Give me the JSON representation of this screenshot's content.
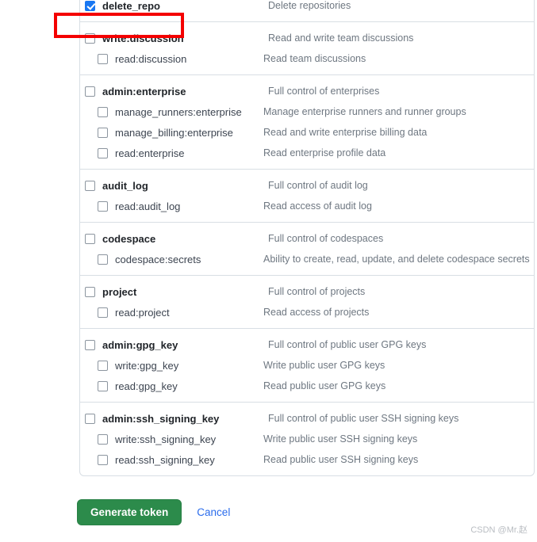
{
  "colors": {
    "accent_checkbox": "#1877f2",
    "primary_button": "#2c8b4b",
    "link": "#2b6cec",
    "highlight_annotation": "#f40000",
    "border": "#d8dee4",
    "description_text": "#6e7781"
  },
  "highlight": {
    "target_scope": "delete_repo"
  },
  "scope_groups": [
    {
      "group_name": "delete_repo-group",
      "rows": [
        {
          "scope": "delete_repo",
          "description": "Delete repositories",
          "checked": true,
          "level": "parent"
        }
      ]
    },
    {
      "group_name": "discussion-group",
      "rows": [
        {
          "scope": "write:discussion",
          "description": "Read and write team discussions",
          "checked": false,
          "level": "parent"
        },
        {
          "scope": "read:discussion",
          "description": "Read team discussions",
          "checked": false,
          "level": "child"
        }
      ]
    },
    {
      "group_name": "enterprise-group",
      "rows": [
        {
          "scope": "admin:enterprise",
          "description": "Full control of enterprises",
          "checked": false,
          "level": "parent"
        },
        {
          "scope": "manage_runners:enterprise",
          "description": "Manage enterprise runners and runner groups",
          "checked": false,
          "level": "child"
        },
        {
          "scope": "manage_billing:enterprise",
          "description": "Read and write enterprise billing data",
          "checked": false,
          "level": "child"
        },
        {
          "scope": "read:enterprise",
          "description": "Read enterprise profile data",
          "checked": false,
          "level": "child"
        }
      ]
    },
    {
      "group_name": "audit-log-group",
      "rows": [
        {
          "scope": "audit_log",
          "description": "Full control of audit log",
          "checked": false,
          "level": "parent"
        },
        {
          "scope": "read:audit_log",
          "description": "Read access of audit log",
          "checked": false,
          "level": "child"
        }
      ]
    },
    {
      "group_name": "codespace-group",
      "rows": [
        {
          "scope": "codespace",
          "description": "Full control of codespaces",
          "checked": false,
          "level": "parent"
        },
        {
          "scope": "codespace:secrets",
          "description": "Ability to create, read, update, and delete codespace secrets",
          "checked": false,
          "level": "child"
        }
      ]
    },
    {
      "group_name": "project-group",
      "rows": [
        {
          "scope": "project",
          "description": "Full control of projects",
          "checked": false,
          "level": "parent"
        },
        {
          "scope": "read:project",
          "description": "Read access of projects",
          "checked": false,
          "level": "child"
        }
      ]
    },
    {
      "group_name": "gpg-key-group",
      "rows": [
        {
          "scope": "admin:gpg_key",
          "description": "Full control of public user GPG keys",
          "checked": false,
          "level": "parent"
        },
        {
          "scope": "write:gpg_key",
          "description": "Write public user GPG keys",
          "checked": false,
          "level": "child"
        },
        {
          "scope": "read:gpg_key",
          "description": "Read public user GPG keys",
          "checked": false,
          "level": "child"
        }
      ]
    },
    {
      "group_name": "ssh-signing-key-group",
      "rows": [
        {
          "scope": "admin:ssh_signing_key",
          "description": "Full control of public user SSH signing keys",
          "checked": false,
          "level": "parent"
        },
        {
          "scope": "write:ssh_signing_key",
          "description": "Write public user SSH signing keys",
          "checked": false,
          "level": "child"
        },
        {
          "scope": "read:ssh_signing_key",
          "description": "Read public user SSH signing keys",
          "checked": false,
          "level": "child"
        }
      ]
    }
  ],
  "actions": {
    "generate_label": "Generate token",
    "cancel_label": "Cancel"
  },
  "watermark": {
    "text": "CSDN @Mr.赵"
  }
}
